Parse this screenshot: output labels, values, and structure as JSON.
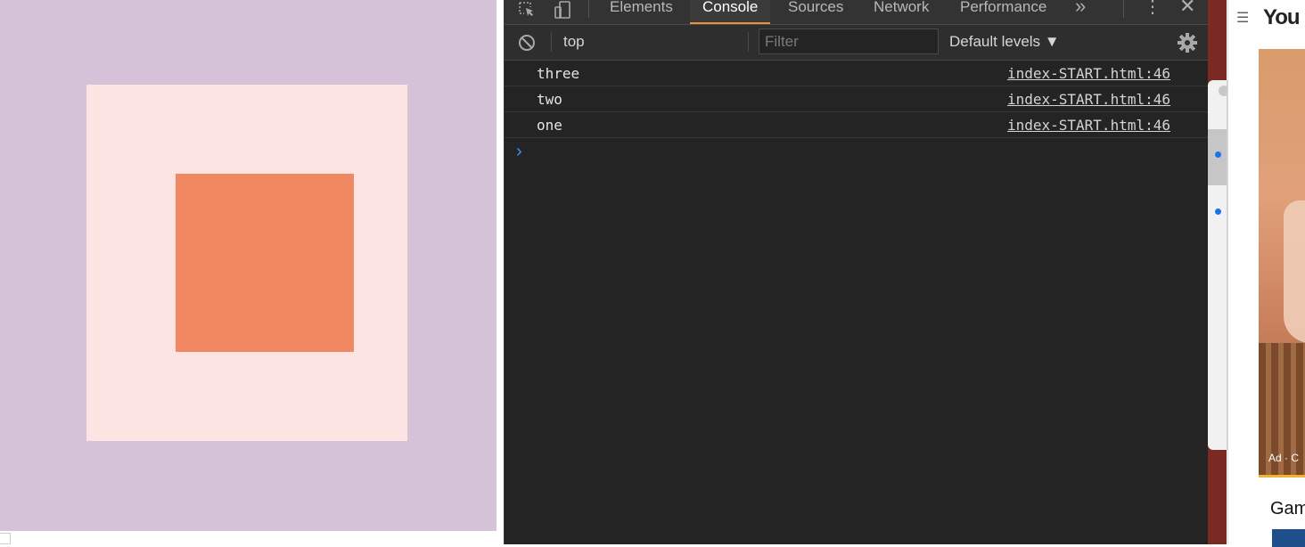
{
  "devtools": {
    "tabs": [
      {
        "label": "Elements",
        "active": false
      },
      {
        "label": "Console",
        "active": true
      },
      {
        "label": "Sources",
        "active": false
      },
      {
        "label": "Network",
        "active": false
      },
      {
        "label": "Performance",
        "active": false
      }
    ],
    "more_tabs": "»",
    "toolbar": {
      "context": "top",
      "filter_placeholder": "Filter",
      "levels": "Default levels ▼"
    },
    "messages": [
      {
        "text": "three",
        "source": "index-START.html:46"
      },
      {
        "text": "two",
        "source": "index-START.html:46"
      },
      {
        "text": "one",
        "source": "index-START.html:46"
      }
    ],
    "prompt": "›"
  },
  "demo": {
    "background": "#d5c2d9",
    "outer_color": "#fbe4e2",
    "inner_color": "#f08861"
  },
  "side_window": {
    "title": "You",
    "ad_label": "Ad · C",
    "below_title": "Gam"
  },
  "colors": {
    "accent_tab": "#e8943c",
    "prompt_blue": "#4c8cf5"
  }
}
